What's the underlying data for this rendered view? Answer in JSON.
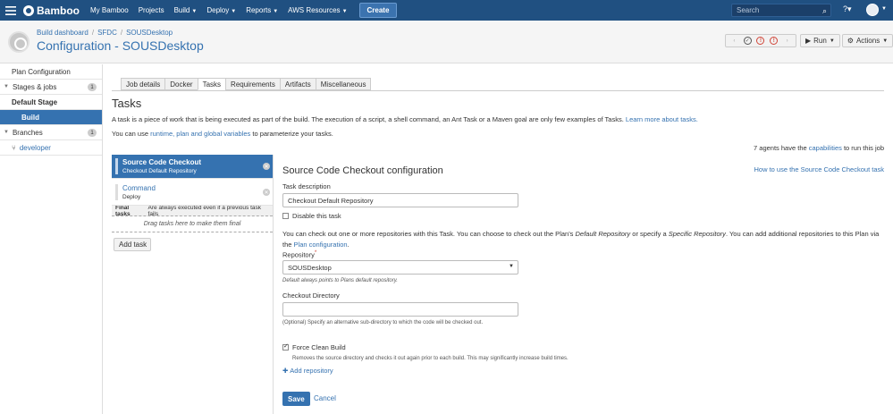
{
  "topnav": {
    "logo": "Bamboo",
    "items": [
      {
        "label": "My Bamboo",
        "caret": false
      },
      {
        "label": "Projects",
        "caret": false
      },
      {
        "label": "Build",
        "caret": true
      },
      {
        "label": "Deploy",
        "caret": true
      },
      {
        "label": "Reports",
        "caret": true
      },
      {
        "label": "AWS Resources",
        "caret": true
      }
    ],
    "create_label": "Create",
    "search_placeholder": "Search"
  },
  "header": {
    "breadcrumb": [
      "Build dashboard",
      "SFDC",
      "SOUSDesktop"
    ],
    "title": "Configuration - SOUSDesktop",
    "run_label": "Run",
    "actions_label": "Actions"
  },
  "sidebar": {
    "plan_configuration": "Plan Configuration",
    "stages_label": "Stages & jobs",
    "stages_count": "1",
    "default_stage": "Default Stage",
    "build": "Build",
    "branches_label": "Branches",
    "branches_count": "1",
    "branch": "developer"
  },
  "tabs": [
    "Job details",
    "Docker",
    "Tasks",
    "Requirements",
    "Artifacts",
    "Miscellaneous"
  ],
  "tasks_page": {
    "title": "Tasks",
    "intro_text": "A task is a piece of work that is being executed as part of the build. The execution of a script, a shell command, an Ant Task or a Maven goal are only few examples of Tasks.",
    "intro_link": "Learn more about tasks.",
    "vars_prefix": "You can use",
    "vars_link": "runtime, plan and global variables",
    "vars_suffix": "to parameterize your tasks.",
    "agents_prefix": "7 agents have the",
    "agents_link": "capabilities",
    "agents_suffix": "to run this job"
  },
  "task_list": [
    {
      "name": "Source Code Checkout",
      "desc": "Checkout Default Repository"
    },
    {
      "name": "Command",
      "desc": "Deploy"
    }
  ],
  "final_tasks": {
    "label": "Final tasks",
    "note": "Are always executed even if a previous task fails",
    "drag_hint": "Drag tasks here to make them final"
  },
  "add_task_label": "Add task",
  "config": {
    "title": "Source Code Checkout configuration",
    "help_link": "How to use the Source Code Checkout task",
    "task_description_label": "Task description",
    "task_description_value": "Checkout Default Repository",
    "disable_label": "Disable this task",
    "repo_info_1": "You can check out one or more repositories with this Task. You can choose to check out the Plan's",
    "repo_info_default": "Default Repository",
    "repo_info_2": "or specify a",
    "repo_info_specific": "Specific Repository",
    "repo_info_3": ". You can add additional repositories to this Plan via the",
    "repo_info_link": "Plan configuration",
    "repository_label": "Repository",
    "repository_value": "SOUSDesktop",
    "repository_hint": "Default always points to Plans default repository.",
    "repository_hint_em": "Default",
    "checkout_dir_label": "Checkout Directory",
    "checkout_dir_value": "",
    "checkout_dir_hint": "(Optional) Specify an alternative sub-directory to which the code will be checked out.",
    "force_clean_label": "Force Clean Build",
    "force_clean_hint": "Removes the source directory and checks it out again prior to each build. This may significantly increase build times.",
    "add_repo_label": "Add repository",
    "save_label": "Save",
    "cancel_label": "Cancel"
  }
}
